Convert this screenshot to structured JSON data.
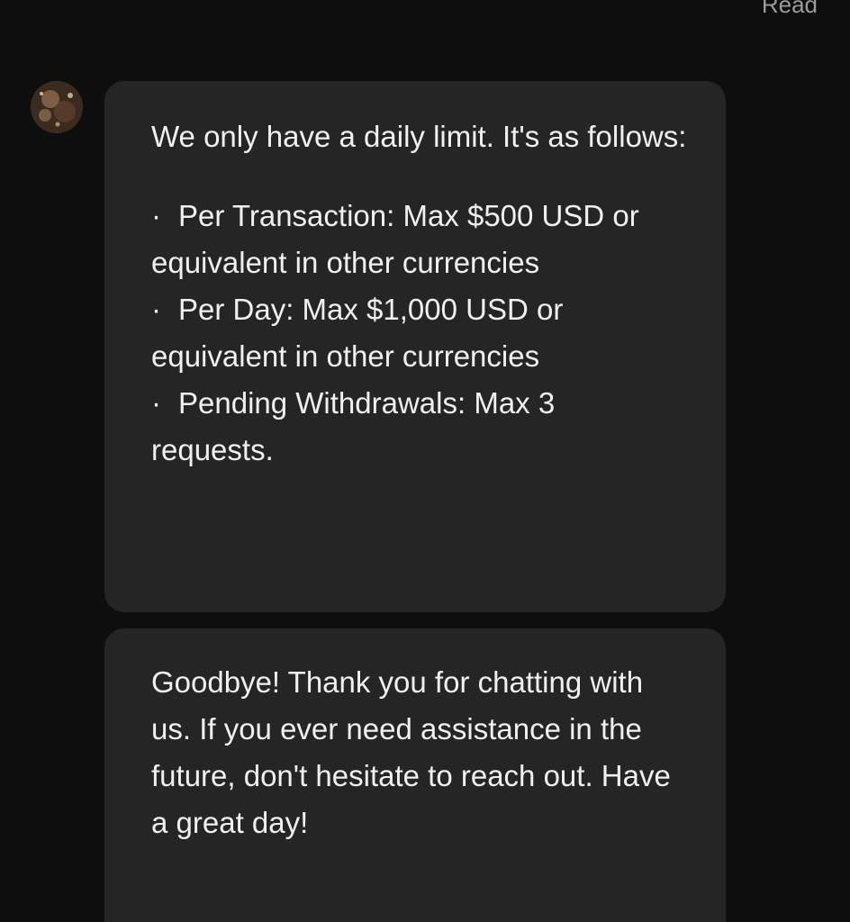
{
  "status": {
    "read_label": "Read"
  },
  "avatar": {
    "icon": "agent-avatar"
  },
  "messages": [
    {
      "intro": "We only have a daily limit. It's as follows:",
      "items": [
        "Per Transaction: Max $500 USD or equivalent in other currencies",
        "Per Day: Max $1,000 USD or equivalent in other currencies",
        "Pending Withdrawals: Max 3 requests."
      ],
      "bullet": "·"
    },
    {
      "text": "Goodbye! Thank you for chatting with us. If you ever need assistance in the future, don't hesitate to reach out. Have a great day!"
    }
  ],
  "colors": {
    "background": "#0e0e0e",
    "bubble": "#252525",
    "text": "#f0f0f0",
    "muted": "#9a9a9a"
  }
}
